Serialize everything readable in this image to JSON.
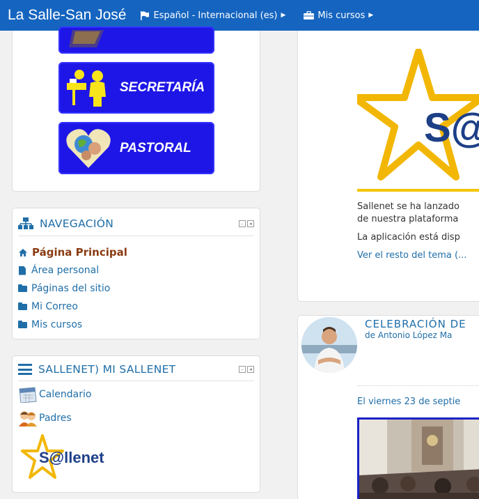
{
  "navbar": {
    "brand": "La Salle-San José",
    "language": "Español - Internacional (es)",
    "courses": "Mis cursos",
    "color": "#1565c0"
  },
  "image_block": {
    "tiles": [
      {
        "label": "",
        "icon": "library-icon"
      },
      {
        "label": "SECRETARÍA",
        "icon": "secretary-desk-icon"
      },
      {
        "label": "PASTORAL",
        "icon": "heart-globe-icon"
      }
    ],
    "tile_color": "#1e16e6"
  },
  "navigation": {
    "title": "NAVEGACIÓN",
    "items": [
      {
        "label": "Página Principal",
        "icon": "home-icon"
      },
      {
        "label": "Área personal",
        "icon": "file-icon"
      },
      {
        "label": "Páginas del sitio",
        "icon": "folder-icon"
      },
      {
        "label": "Mi Correo",
        "icon": "folder-icon"
      },
      {
        "label": "Mis cursos",
        "icon": "folder-icon"
      }
    ]
  },
  "sallenet_block": {
    "title": "SALLENET) MI SALLENET",
    "items": [
      {
        "label": "Calendario",
        "icon": "calendar-icon"
      },
      {
        "label": "Padres",
        "icon": "parents-icon"
      }
    ],
    "logo_text": "S@llenet"
  },
  "news": {
    "logo_text": "S@",
    "line1": "Sallenet se ha lanzado",
    "line2": "de nuestra plataforma",
    "line3": "La aplicación está disp",
    "more": "Ver el resto del tema (..."
  },
  "post": {
    "title": "CELEBRACIÓN DE",
    "author": "de Antonio López Ma",
    "text": "El viernes 23 de septie"
  }
}
